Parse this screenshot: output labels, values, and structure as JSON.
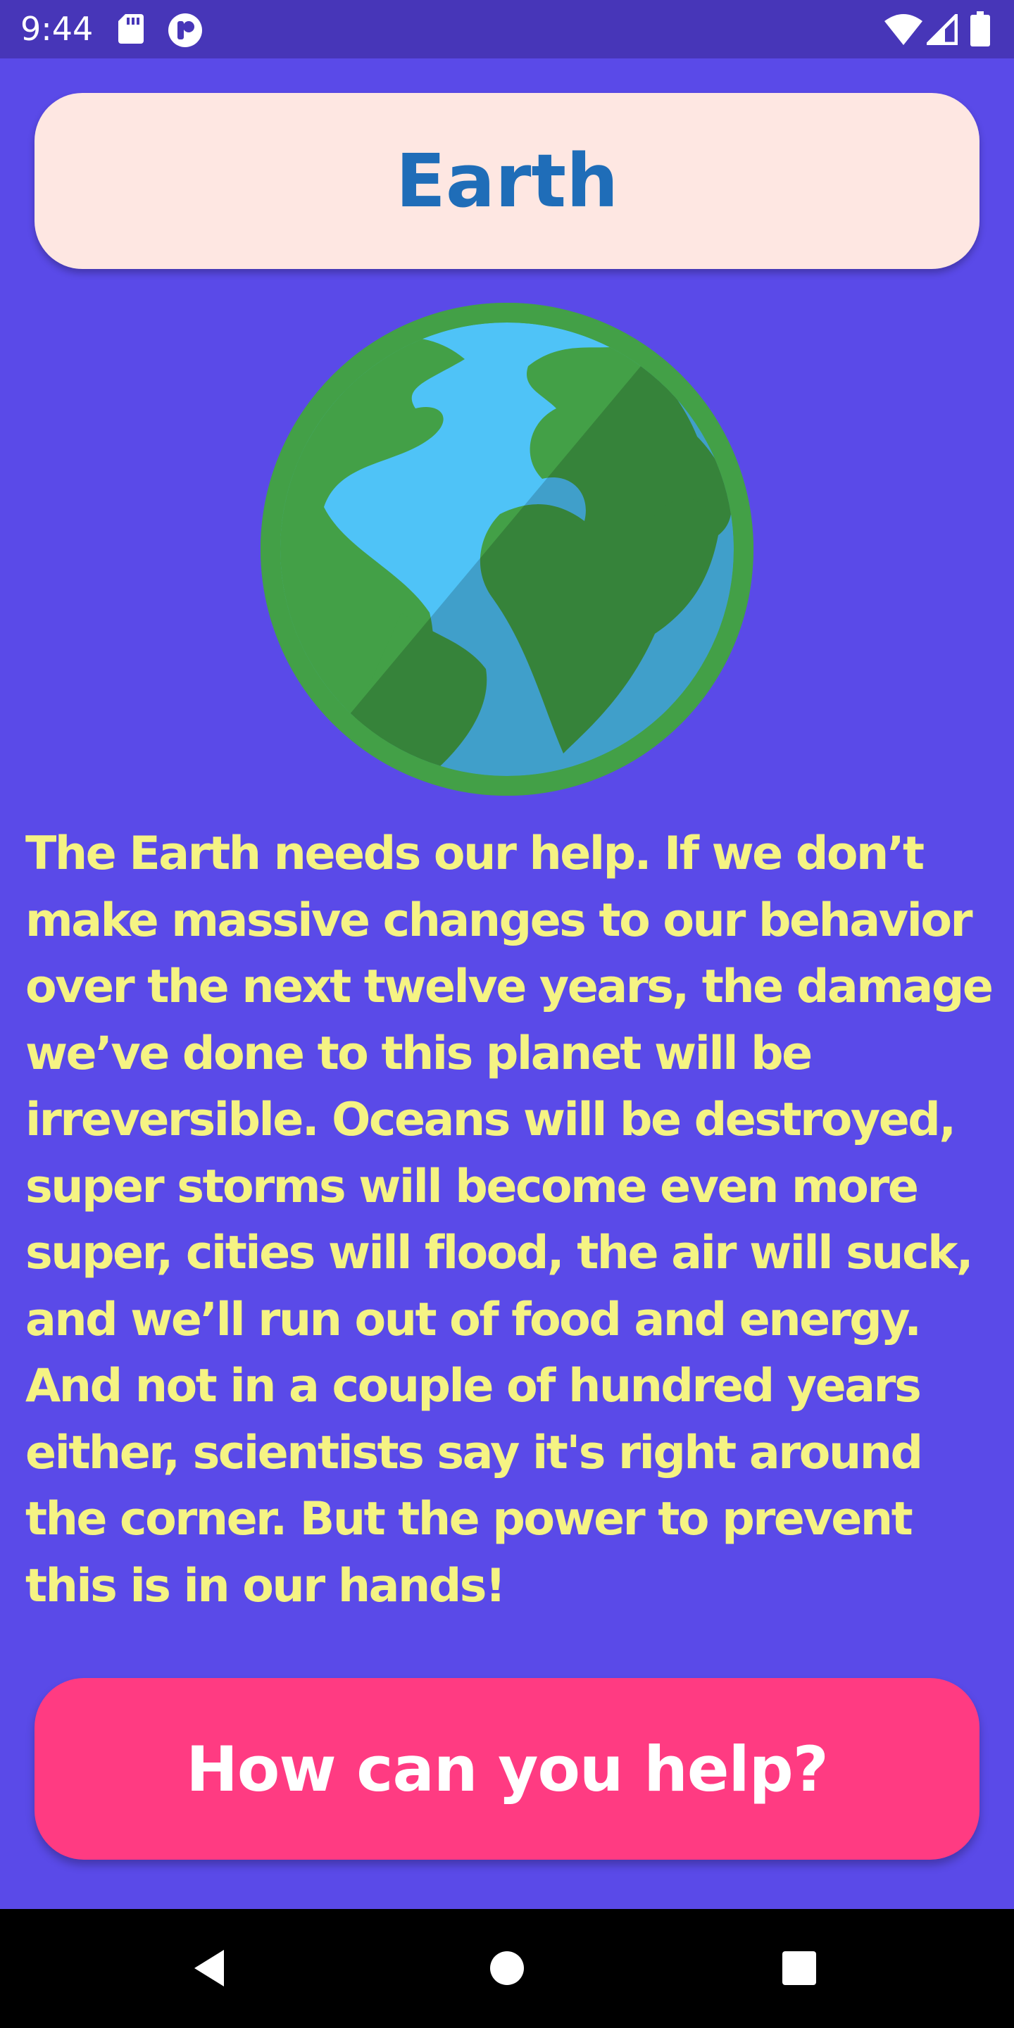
{
  "status_bar": {
    "time": "9:44",
    "icons": [
      "sd-card-icon",
      "app-notification-icon",
      "wifi-icon",
      "cell-signal-icon",
      "battery-icon"
    ]
  },
  "header": {
    "title": "Earth"
  },
  "hero": {
    "image": "earth-globe-icon"
  },
  "main": {
    "description": "The Earth needs our help. If we don’t make massive changes to our behavior over the next twelve years, the damage we’ve done to this planet will be irreversible. Oceans will be destroyed, super storms will become even more super, cities will flood, the air will suck, and we’ll run out of food and energy. And not in a couple of hundred years either, scientists say it's right around the corner. But the power to prevent this is in our hands!"
  },
  "cta": {
    "label": "How can you help?"
  },
  "nav_bar": {
    "buttons": [
      "back-icon",
      "home-icon",
      "recent-apps-icon"
    ]
  },
  "colors": {
    "background": "#5a4ae8",
    "status_bar": "#4736b8",
    "title_card": "#fee7e2",
    "title_text": "#1f6db8",
    "body_text": "#f5f383",
    "button": "#ff3b82"
  }
}
